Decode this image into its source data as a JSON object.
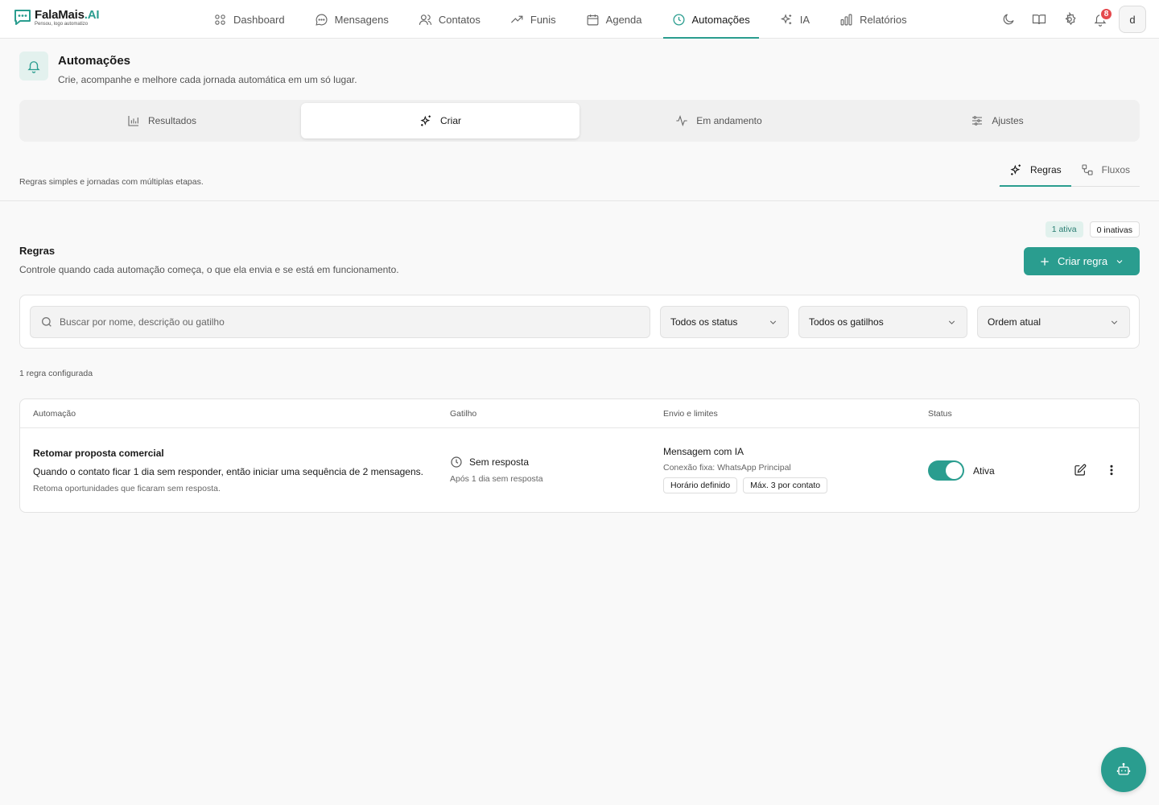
{
  "brand": {
    "name": "FalaMais",
    "name_suffix": ".AI",
    "tagline": "Pensou, logo automatizo"
  },
  "nav": [
    {
      "label": "Dashboard",
      "icon": "grid-icon"
    },
    {
      "label": "Mensagens",
      "icon": "chat-icon"
    },
    {
      "label": "Contatos",
      "icon": "users-icon"
    },
    {
      "label": "Funis",
      "icon": "trend-icon"
    },
    {
      "label": "Agenda",
      "icon": "calendar-icon"
    },
    {
      "label": "Automações",
      "icon": "clock-icon",
      "active": true
    },
    {
      "label": "IA",
      "icon": "sparkles-icon"
    },
    {
      "label": "Relatórios",
      "icon": "bar-chart-icon"
    }
  ],
  "top_actions": {
    "notifications_count": "8",
    "avatar_letter": "d"
  },
  "page": {
    "title": "Automações",
    "subtitle": "Crie, acompanhe e melhore cada jornada automática em um só lugar."
  },
  "tabs": [
    {
      "label": "Resultados",
      "icon": "bar-chart-icon"
    },
    {
      "label": "Criar",
      "icon": "sparkles-icon",
      "active": true
    },
    {
      "label": "Em andamento",
      "icon": "activity-icon"
    },
    {
      "label": "Ajustes",
      "icon": "sliders-icon"
    }
  ],
  "section": {
    "description": "Regras simples e jornadas com múltiplas etapas.",
    "subtabs": [
      {
        "label": "Regras",
        "icon": "sparkles-icon",
        "active": true
      },
      {
        "label": "Fluxos",
        "icon": "flow-icon"
      }
    ]
  },
  "rules": {
    "active_pill": "1 ativa",
    "inactive_pill": "0 inativas",
    "title": "Regras",
    "subtitle": "Controle quando cada automação começa, o que ela envia e se está em funcionamento.",
    "create_label": "Criar regra"
  },
  "filters": {
    "search_placeholder": "Buscar por nome, descrição ou gatilho",
    "status": "Todos os status",
    "trigger": "Todos os gatilhos",
    "order": "Ordem atual"
  },
  "count_label": "1 regra configurada",
  "table": {
    "headers": [
      "Automação",
      "Gatilho",
      "Envio e limites",
      "Status"
    ],
    "rows": [
      {
        "name": "Retomar proposta comercial",
        "description": "Quando o contato ficar 1 dia sem responder, então iniciar uma sequência de 2 mensagens.",
        "note": "Retoma oportunidades que ficaram sem resposta.",
        "trigger": "Sem resposta",
        "trigger_detail": "Após 1 dia sem resposta",
        "send_title": "Mensagem com IA",
        "send_connection": "Conexão fixa: WhatsApp Principal",
        "chips": [
          "Horário definido",
          "Máx. 3 por contato"
        ],
        "status": "Ativa",
        "enabled": true
      }
    ]
  },
  "colors": {
    "accent": "#2a9d8f",
    "badge": "#e5484d"
  }
}
